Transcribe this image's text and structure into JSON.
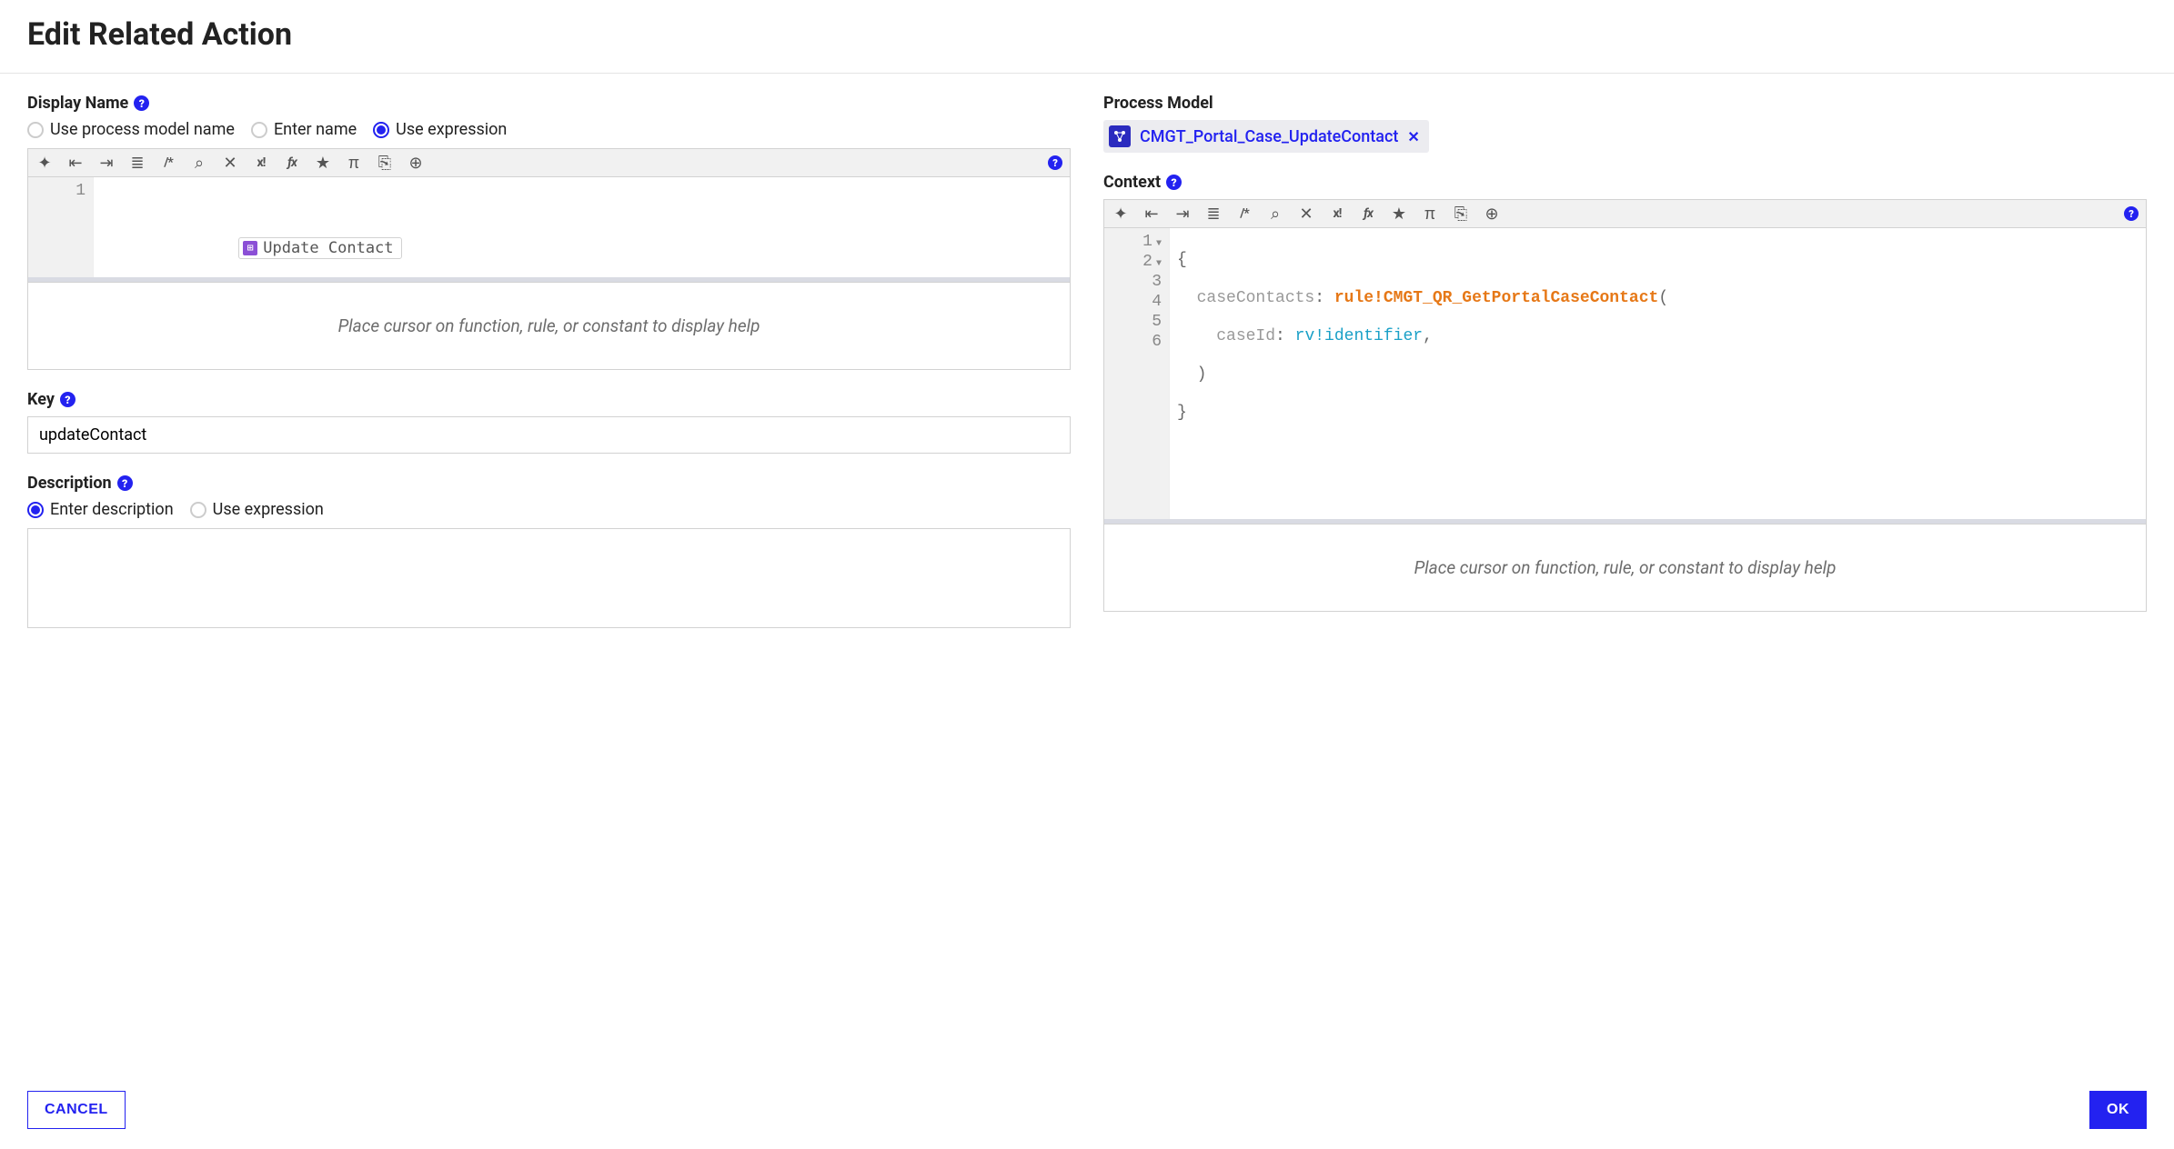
{
  "dialog": {
    "title": "Edit Related Action"
  },
  "display_name": {
    "label": "Display Name",
    "options": {
      "use_pm": "Use process model name",
      "enter": "Enter name",
      "expr": "Use expression"
    },
    "selected": "expr",
    "editor": {
      "line_numbers": [
        "1"
      ],
      "chip_text": "Update Contact"
    },
    "hint": "Place cursor on function, rule, or constant to display help"
  },
  "key": {
    "label": "Key",
    "value": "updateContact"
  },
  "description": {
    "label": "Description",
    "options": {
      "enter": "Enter description",
      "expr": "Use expression"
    },
    "selected": "enter",
    "value": ""
  },
  "process_model": {
    "label": "Process Model",
    "chip": "CMGT_PortalCase_UpdateContact",
    "chip_display": "CMGT_Portal_Case_UpdateContact"
  },
  "context": {
    "label": "Context",
    "hint": "Place cursor on function, rule, or constant to display help",
    "line_numbers": [
      "1",
      "2",
      "3",
      "4",
      "5",
      "6"
    ],
    "folds": {
      "1": true,
      "2": true
    },
    "tokens": {
      "l1_open": "{",
      "l2_key": "caseContacts",
      "l2_colon": ": ",
      "l2_rule": "rule!CMGT_QR_GetPortalCaseContact",
      "l2_paren": "(",
      "l3_key": "caseId",
      "l3_colon": ": ",
      "l3_rv": "rv!identifier",
      "l3_comma": ",",
      "l4_close_paren": ")",
      "l5_close_brace": "}"
    }
  },
  "toolbar": {
    "magic": "✦",
    "outdent": "⇤",
    "indent": "⇥",
    "list": "≣",
    "comment": "/*",
    "search": "⌕",
    "shuffle": "✕",
    "exclaim": "x!",
    "fx": "ƒx",
    "star": "★",
    "pi": "π",
    "export": "⎘",
    "globe": "⊕"
  },
  "footer": {
    "cancel": "CANCEL",
    "ok": "OK"
  }
}
